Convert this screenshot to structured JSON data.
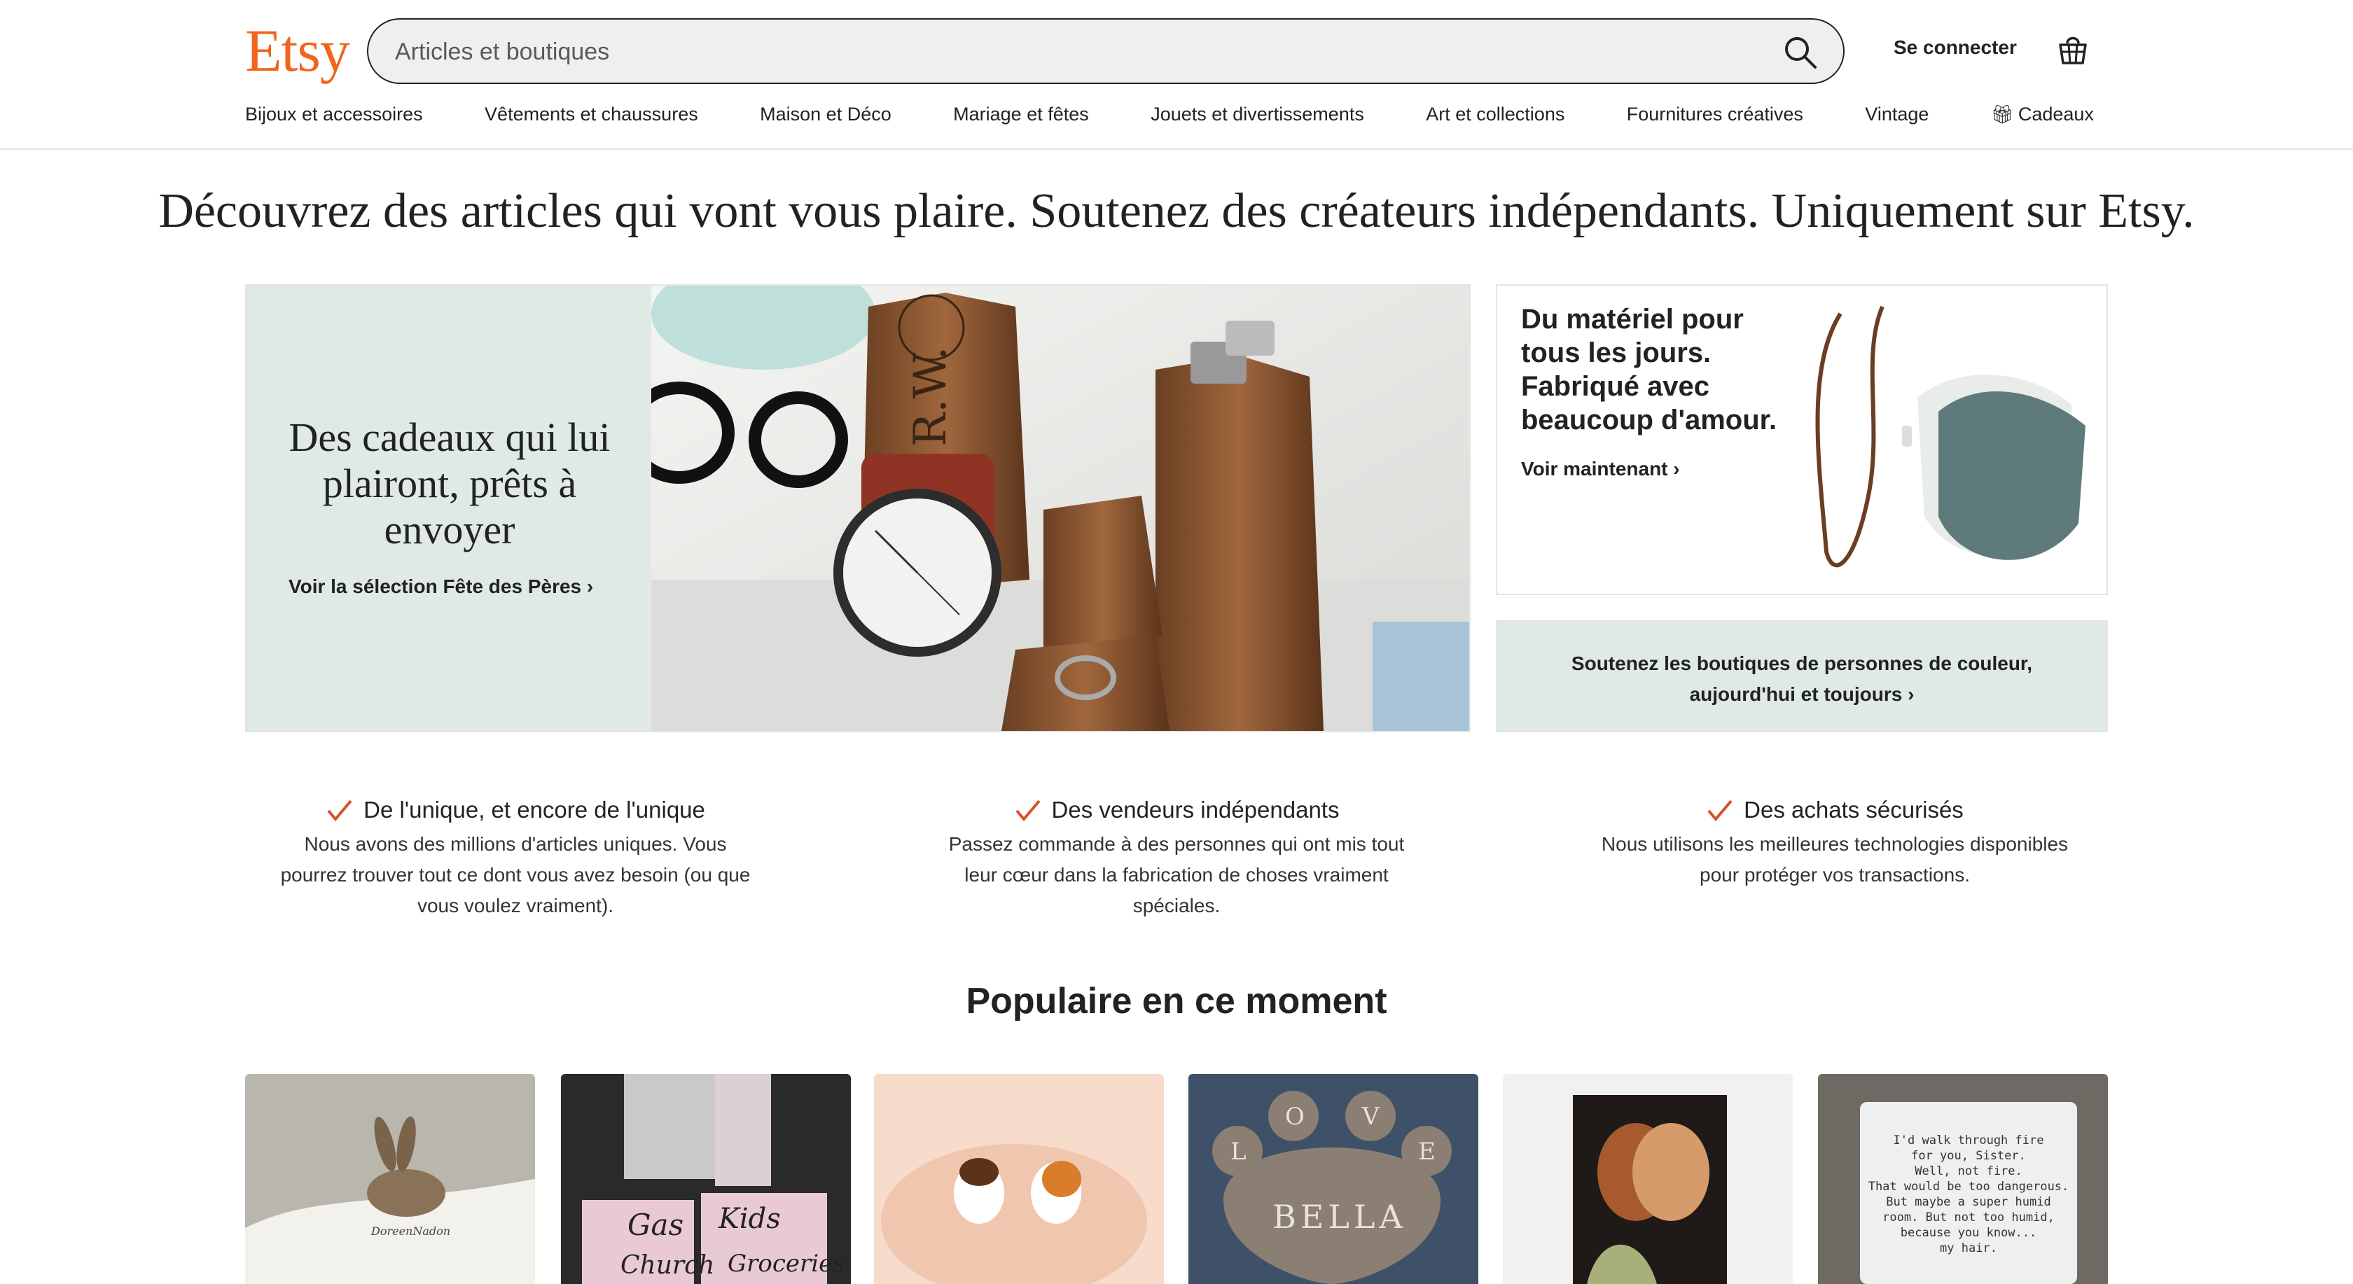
{
  "header": {
    "logo": "Etsy",
    "search_placeholder": "Articles et boutiques",
    "signin_label": "Se connecter"
  },
  "nav": {
    "items": [
      {
        "label": "Bijoux et accessoires"
      },
      {
        "label": "Vêtements et chaussures"
      },
      {
        "label": "Maison et Déco"
      },
      {
        "label": "Mariage et fêtes"
      },
      {
        "label": "Jouets et divertissements"
      },
      {
        "label": "Art et collections"
      },
      {
        "label": "Fournitures créatives"
      },
      {
        "label": "Vintage"
      },
      {
        "label": "Cadeaux",
        "icon": "gift-icon"
      }
    ]
  },
  "hero": {
    "headline": "Découvrez des articles qui vont vous plaire. Soutenez des créateurs indépendants. Uniquement sur Etsy."
  },
  "promo_main": {
    "title": "Des cadeaux qui lui plairont, prêts à envoyer",
    "link": "Voir la sélection Fête des Pères",
    "image_label": "R.W."
  },
  "promo_side": {
    "title": "Du matériel pour tous les jours. Fabriqué avec beaucoup d'amour.",
    "link": "Voir maintenant"
  },
  "promo_band": {
    "line1": "Soutenez les boutiques de personnes de couleur,",
    "line2": "aujourd'hui et toujours"
  },
  "value_props": [
    {
      "title": "De l'unique, et encore de l'unique",
      "desc": "Nous avons des millions d'articles uniques. Vous pourrez trouver tout ce dont vous avez besoin (ou que vous voulez vraiment)."
    },
    {
      "title": "Des vendeurs indépendants",
      "desc": "Passez commande à des personnes qui ont mis tout leur cœur dans la fabrication de choses vraiment spéciales."
    },
    {
      "title": "Des achats sécurisés",
      "desc": "Nous utilisons les meilleures technologies disponibles pour protéger vos transactions."
    }
  ],
  "popular": {
    "title": "Populaire en ce moment",
    "tiles": [
      {
        "image": "bunny-book-photo",
        "caption": "DoreenNadon"
      },
      {
        "image": "budget-binder-photo",
        "words": [
          "Gas",
          "Kids",
          "Church",
          "Groceries"
        ]
      },
      {
        "image": "guinea-pig-minis-photo"
      },
      {
        "image": "paw-stone-photo",
        "letters": [
          "L",
          "O",
          "V",
          "E"
        ],
        "name": "BELLA"
      },
      {
        "image": "art-print-photo"
      },
      {
        "image": "candle-jar-photo",
        "lines": [
          "I'd walk through fire",
          "for you, Sister.",
          "Well, not fire.",
          "That would be too dangerous.",
          "But maybe a super humid",
          "room. But not too humid,",
          "because you know...",
          "my hair."
        ]
      }
    ]
  },
  "colors": {
    "brand": "#F1641E",
    "mint": "#dfeae4",
    "text": "#222222"
  }
}
